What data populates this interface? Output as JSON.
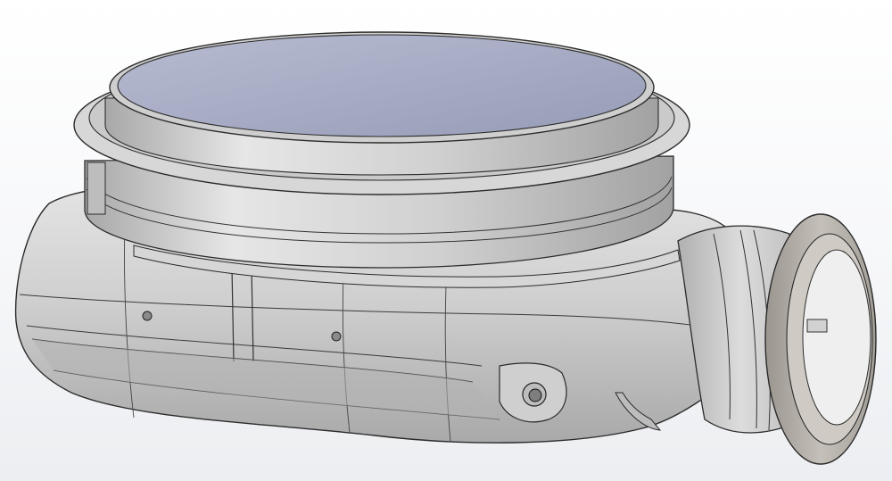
{
  "scene": {
    "subject_icon": "cad-blower-housing-icon",
    "colors": {
      "background": "#f6f7f9",
      "body": "#c9c9c9",
      "body_light": "#dedede",
      "body_dark": "#9a9a9a",
      "edge": "#2b2b2b",
      "lid_face": "#9ea3bd",
      "lid_face_light": "#b4b8cf",
      "flange": "#b8b4ad",
      "duct_inner": "#f0f0f0"
    }
  }
}
